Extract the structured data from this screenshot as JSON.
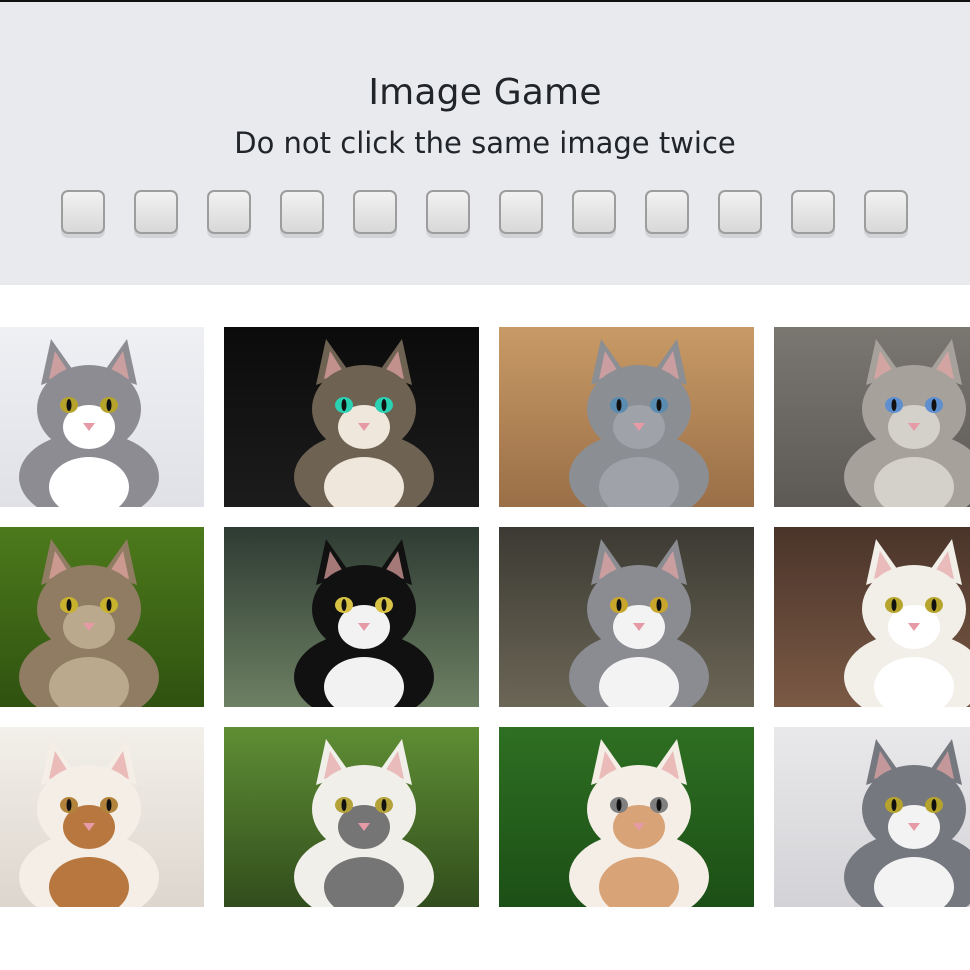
{
  "header": {
    "title": "Image Game",
    "subtitle": "Do not click the same image twice"
  },
  "score_boxes": [
    {
      "filled": false
    },
    {
      "filled": false
    },
    {
      "filled": false
    },
    {
      "filled": false
    },
    {
      "filled": false
    },
    {
      "filled": false
    },
    {
      "filled": false
    },
    {
      "filled": false
    },
    {
      "filled": false
    },
    {
      "filled": false
    },
    {
      "filled": false
    },
    {
      "filled": false
    }
  ],
  "images": [
    {
      "name": "gray-white-cat-image",
      "bg": "#eff0f4",
      "bg2": "#dfe1e6",
      "fur": "#8c8c92",
      "fur2": "#ffffff",
      "eye": "#b5a32c"
    },
    {
      "name": "tabby-cat-dark-image",
      "bg": "#0b0b0b",
      "bg2": "#1c1c1c",
      "fur": "#6e6252",
      "fur2": "#efe6dc",
      "eye": "#2ad1b3"
    },
    {
      "name": "gray-scottish-fold-kitten-image",
      "bg": "#c89a66",
      "bg2": "#9a6f47",
      "fur": "#8b8e93",
      "fur2": "#9fa2a8",
      "eye": "#5a8bb0"
    },
    {
      "name": "cat-face-blue-eyes-image",
      "bg": "#7a7670",
      "bg2": "#5d5a56",
      "fur": "#a6a29b",
      "fur2": "#d4d0ca",
      "eye": "#5e8fd0"
    },
    {
      "name": "tabby-cat-in-flowers-image",
      "bg": "#4d7a1c",
      "bg2": "#2f5210",
      "fur": "#8f7c62",
      "fur2": "#bba98e",
      "eye": "#c7b12d"
    },
    {
      "name": "black-white-cat-garden-image",
      "bg": "#2e3b33",
      "bg2": "#6d8063",
      "fur": "#111111",
      "fur2": "#f2f2f2",
      "eye": "#d8c245"
    },
    {
      "name": "gray-white-cat-lying-image",
      "bg": "#3c3a33",
      "bg2": "#6b6656",
      "fur": "#8b8c92",
      "fur2": "#f3f3f3",
      "eye": "#c7a62b"
    },
    {
      "name": "white-cat-portrait-image",
      "bg": "#4a342a",
      "bg2": "#7b5a45",
      "fur": "#f2efe9",
      "fur2": "#ffffff",
      "eye": "#b6a42c"
    },
    {
      "name": "calico-cat-window-image",
      "bg": "#f3f0ea",
      "bg2": "#dcd6cd",
      "fur": "#f4eee6",
      "fur2": "#b7773f",
      "eye": "#b2833b"
    },
    {
      "name": "white-gray-cat-grass-image",
      "bg": "#5f8e34",
      "bg2": "#314d1d",
      "fur": "#f0efea",
      "fur2": "#757575",
      "eye": "#b3a23a"
    },
    {
      "name": "orange-white-cat-grass-image",
      "bg": "#2e6f22",
      "bg2": "#1c4f16",
      "fur": "#f4eee7",
      "fur2": "#d8a377",
      "eye": "#7f7f7f"
    },
    {
      "name": "gray-kitten-blanket-image",
      "bg": "#e9e8ea",
      "bg2": "#d3d2d6",
      "fur": "#76787f",
      "fur2": "#f4f3f4",
      "eye": "#b5a32c"
    }
  ]
}
